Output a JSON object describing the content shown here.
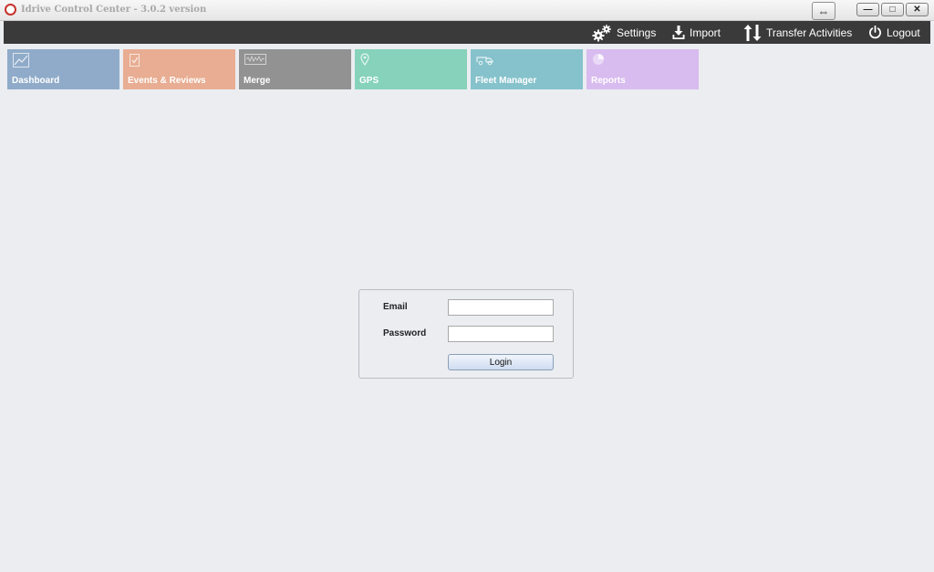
{
  "window": {
    "title": "Idrive Control Center - 3.0.2 version",
    "restore_glyph": "⇔",
    "minimize_glyph": "—",
    "maximize_glyph": "□",
    "close_glyph": "✕"
  },
  "navbar": {
    "items": [
      {
        "label": "Settings",
        "icon": "gears-icon"
      },
      {
        "label": "Import",
        "icon": "download-icon"
      },
      {
        "label": "Transfer Activities",
        "icon": "transfer-icon"
      },
      {
        "label": "Logout",
        "icon": "power-icon"
      }
    ]
  },
  "tiles": [
    {
      "label": "Dashboard",
      "color": "#8fabc9",
      "icon": "chart-icon"
    },
    {
      "label": "Events & Reviews",
      "color": "#e8ad92",
      "icon": "checklist-icon"
    },
    {
      "label": "Merge",
      "color": "#929292",
      "icon": "waveform-icon"
    },
    {
      "label": "GPS",
      "color": "#86d2bb",
      "icon": "map-pin-icon"
    },
    {
      "label": "Fleet Manager",
      "color": "#86c2cc",
      "icon": "truck-icon"
    },
    {
      "label": "Reports",
      "color": "#d8bbef",
      "icon": "pie-chart-icon"
    }
  ],
  "login": {
    "email_label": "Email",
    "email_value": "",
    "password_label": "Password",
    "password_value": "",
    "button_label": "Login"
  },
  "colors": {
    "background": "#ebedf1",
    "navbar": "#3a3a3a"
  }
}
